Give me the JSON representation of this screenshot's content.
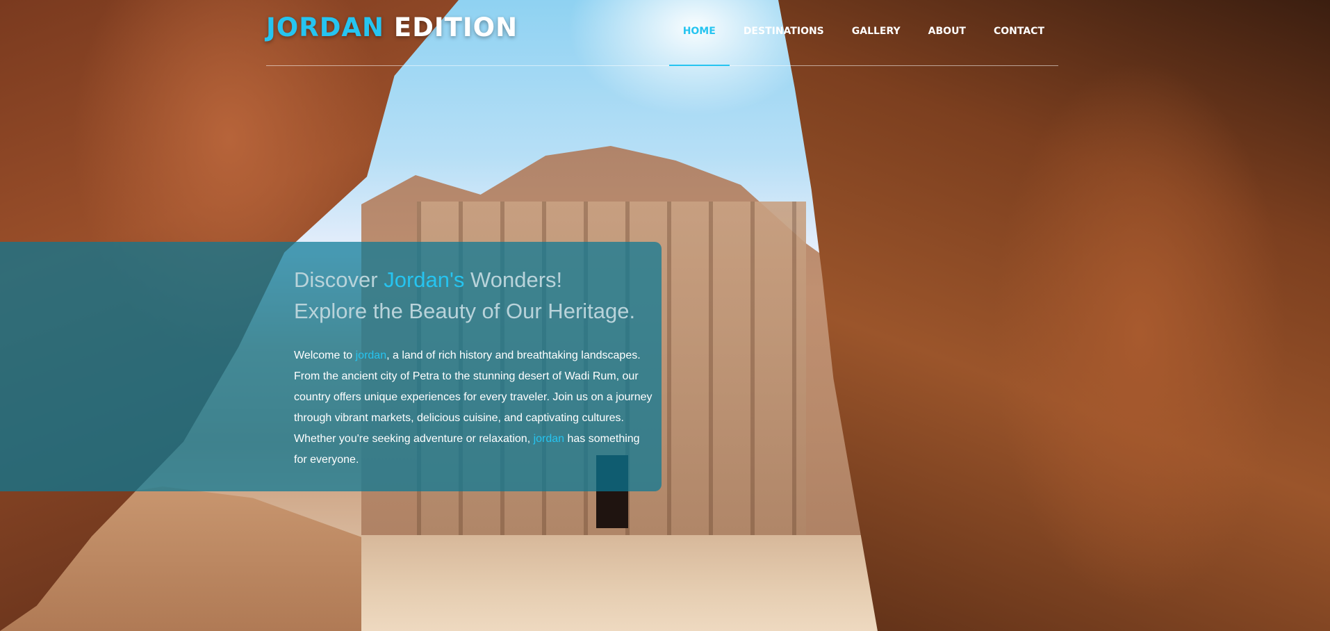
{
  "brand": {
    "part1": "JORDAN",
    "part2": " EDITION"
  },
  "nav": {
    "items": [
      {
        "label": "HOME",
        "active": true
      },
      {
        "label": "DESTINATIONS",
        "active": false
      },
      {
        "label": "GALLERY",
        "active": false
      },
      {
        "label": "ABOUT",
        "active": false
      },
      {
        "label": "CONTACT",
        "active": false
      }
    ]
  },
  "hero": {
    "headline": {
      "part1": "Discover ",
      "highlight": "Jordan's",
      "part2": " Wonders!",
      "line2": "Explore the Beauty of Our Heritage."
    },
    "description": {
      "seg1": "Welcome to ",
      "hl1": "jordan",
      "seg2": ", a land of rich history and breathtaking landscapes. From the ancient city of Petra to the stunning desert of Wadi Rum, our country offers unique experiences for every traveler. Join us on a journey through vibrant markets, delicious cuisine, and captivating cultures. Whether you're seeking adventure or relaxation, ",
      "hl2": "jordan",
      "seg3": " has something for everyone."
    }
  },
  "colors": {
    "accent": "#26c4f0",
    "panel": "#0a7896",
    "text": "#ffffff"
  }
}
